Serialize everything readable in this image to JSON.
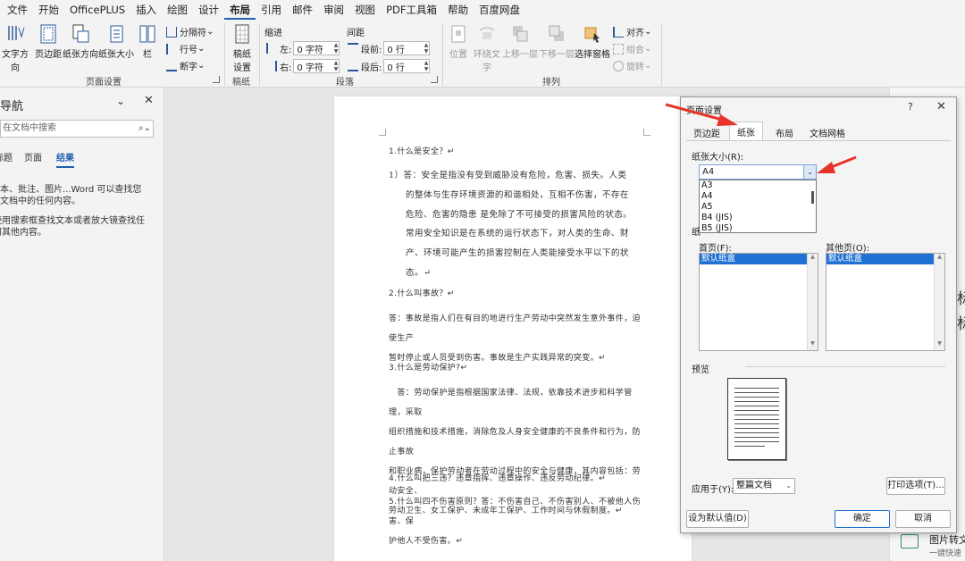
{
  "menu": {
    "tabs": [
      "文件",
      "开始",
      "OfficePLUS",
      "插入",
      "绘图",
      "设计",
      "布局",
      "引用",
      "邮件",
      "审阅",
      "视图",
      "PDF工具箱",
      "帮助",
      "百度网盘"
    ],
    "active": "布局"
  },
  "ribbon": {
    "page_setup": {
      "text_direction": "文字方向",
      "margins": "页边距",
      "orientation": "纸张方向",
      "size": "纸张大小",
      "columns": "栏",
      "breaks": "分隔符",
      "line_numbers": "行号",
      "hyphenation": "断字",
      "group_label": "页面设置"
    },
    "manuscript": {
      "label": "稿纸\n设置",
      "group_label": "稿纸"
    },
    "paragraph": {
      "indent_label": "缩进",
      "spacing_label": "间距",
      "left_label": "左:",
      "left_value": "0 字符",
      "right_label": "右:",
      "right_value": "0 字符",
      "before_label": "段前:",
      "before_value": "0 行",
      "after_label": "段后:",
      "after_value": "0 行",
      "group_label": "段落"
    },
    "arrange": {
      "position": "位置",
      "wrap_text": "环绕文\n字",
      "bring_forward": "上移一层",
      "send_backward": "下移一层",
      "selection_pane": "选择窗格",
      "align": "对齐",
      "group": "组合",
      "rotate": "旋转",
      "group_label": "排列"
    }
  },
  "nav": {
    "title": "导航",
    "search_placeholder": "在文档中搜索",
    "tabs": [
      "标题",
      "页面",
      "结果"
    ],
    "active_tab": "结果",
    "hint1": "文本、批注、图片...Word 可以查找您的文档中的任何内容。",
    "hint2": "使用搜索框查找文本或者放大镜查找任何其他内容。"
  },
  "document": {
    "q1": "1.什么是安全？↵",
    "a1_lines": [
      "1）答：安全是指没有受到威胁没有危险，危害、损失。人类",
      "的整体与生存环境资源的和谐相处，互相不伤害，不存在",
      "危险、危害的隐患 是免除了不可接受的损害风险的状态。",
      "常用安全知识是在系统的运行状态下，对人类的生命、财",
      "产、环境可能产生的损害控制在人类能接受水平以下的状",
      "态。↵"
    ],
    "q2": "2.什么叫事故？↵",
    "a2_lines": [
      "答：事故是指人们在有目的地进行生产劳动中突然发生意外事件，迫使生产",
      "暂时停止或人员受到伤害。事故是生产实践异常的突变。↵"
    ],
    "q3": "3.什么是劳动保护?↵",
    "a3_lines": [
      "　答：劳动保护是指根据国家法律、法规，依靠技术进步和科学管理，采取",
      "组织措施和技术措施，消除危及人身安全健康的不良条件和行为，防止事故",
      "和职业病，保护劳动者在劳动过程中的安全与健康，其内容包括：劳动安全、",
      "劳动卫生、女工保护、未成年工保护、工作时间与休假制度。↵"
    ],
    "q4": "4.什么叫把三违？违章指挥、违章操作、违反劳动纪律。↵",
    "q5_lines": [
      "5.什么叫四不伤害原则？答：不伤害自己、不伤害别人、不被他人伤害、保",
      "护他人不受伤害。↵"
    ]
  },
  "right_panel": {
    "frag1": "标",
    "frag2": "标",
    "convert_title": "图片转文",
    "convert_sub": "一键快速"
  },
  "dialog": {
    "title": "页面设置",
    "help": "?",
    "tabs": [
      "页边距",
      "纸张",
      "布局",
      "文档网格"
    ],
    "active_tab": "纸张",
    "paper_size_label": "纸张大小(R):",
    "paper_size_value": "A4",
    "paper_options": [
      "A3",
      "A4",
      "A5",
      "B4 (JIS)",
      "B5 (JIS)"
    ],
    "paper_source_frag": "纸",
    "first_page_label": "首页(F):",
    "other_pages_label": "其他页(O):",
    "first_page_tray": "默认纸盒",
    "other_pages_tray": "默认纸盒",
    "preview_label": "预览",
    "apply_to_label": "应用于(Y):",
    "apply_to_value": "整篇文档",
    "print_options": "打印选项(T)...",
    "set_default": "设为默认值(D)",
    "ok": "确定",
    "cancel": "取消"
  },
  "colors": {
    "accent": "#1f5fae",
    "selection": "#1f72d4",
    "annotation": "#e8332a"
  }
}
